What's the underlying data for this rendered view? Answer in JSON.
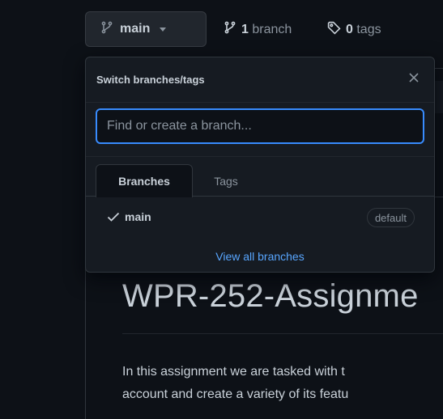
{
  "header": {
    "branch_button_label": "main",
    "branches_count": "1",
    "branches_label": "branch",
    "tags_count": "0",
    "tags_label": "tags"
  },
  "dropdown": {
    "title": "Switch branches/tags",
    "search_placeholder": "Find or create a branch...",
    "tabs": [
      {
        "label": "Branches",
        "active": true
      },
      {
        "label": "Tags",
        "active": false
      }
    ],
    "branches": [
      {
        "name": "main",
        "selected": true,
        "badge": "default"
      }
    ],
    "footer_link": "View all branches"
  },
  "readme": {
    "title": "WPR-252-Assignme",
    "line1": "In this assignment we are tasked with t",
    "line2": "account and create a variety of its featu"
  },
  "colors": {
    "background": "#0d1117",
    "accent": "#58a6ff",
    "focus_border": "#388bfd"
  }
}
